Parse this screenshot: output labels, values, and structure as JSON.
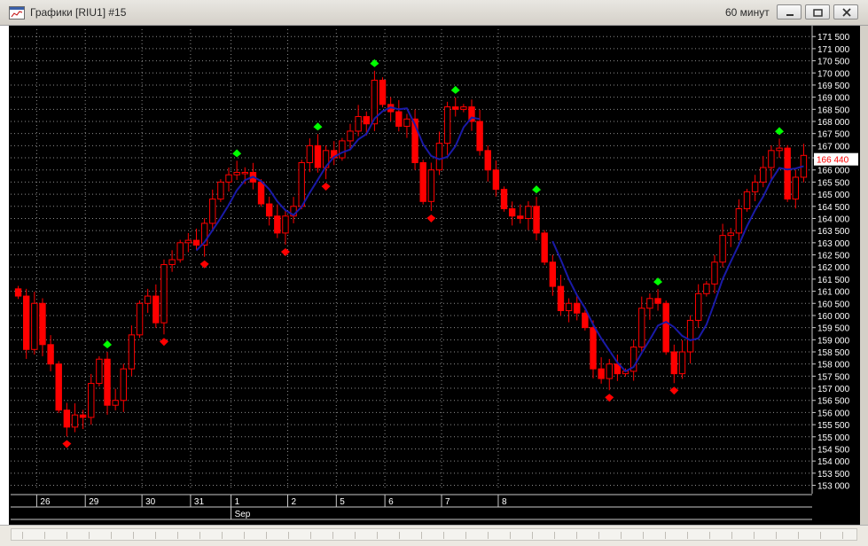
{
  "window": {
    "title": "Графики [RIU1] #15",
    "timeframe": "60 минут",
    "buttons": [
      "minimize",
      "restore",
      "close"
    ],
    "icons": {
      "app": "chart-window-icon",
      "minimize": "minimize-icon",
      "restore": "restore-icon",
      "close": "close-icon"
    }
  },
  "colors": {
    "background": "#000000",
    "grid": "#8c8c8c",
    "bear_candle": "#ff0000",
    "bull_candle": "#ff0000",
    "up_marker": "#00ff00",
    "down_marker": "#ff0000",
    "indicator_line": "#1a1aa8",
    "axis_text": "#ffffff",
    "price_label_bg": "#ffffff",
    "price_label_text": "#ff0000"
  },
  "chart_data": {
    "type": "candlestick",
    "instrument": "RIU1",
    "y_ticks": [
      "153 000",
      "153 500",
      "154 000",
      "154 500",
      "155 000",
      "155 500",
      "156 000",
      "156 500",
      "157 000",
      "157 500",
      "158 000",
      "158 500",
      "159 000",
      "159 500",
      "160 000",
      "160 500",
      "161 000",
      "161 500",
      "162 000",
      "162 500",
      "163 000",
      "163 500",
      "164 000",
      "164 500",
      "165 000",
      "165 500",
      "166 000",
      "166 500",
      "167 000",
      "167 500",
      "168 000",
      "168 500",
      "169 000",
      "169 500",
      "170 000",
      "170 500",
      "171 000",
      "171 500"
    ],
    "ylim": [
      152800,
      171800
    ],
    "last_price_label": "166 440",
    "x_day_labels": [
      {
        "label": "26",
        "index": 3
      },
      {
        "label": "29",
        "index": 9
      },
      {
        "label": "30",
        "index": 16
      },
      {
        "label": "31",
        "index": 22
      },
      {
        "label": "1",
        "index": 27
      },
      {
        "label": "2",
        "index": 34
      },
      {
        "label": "5",
        "index": 40
      },
      {
        "label": "6",
        "index": 46
      },
      {
        "label": "7",
        "index": 53
      },
      {
        "label": "8",
        "index": 60
      }
    ],
    "month_label": {
      "label": "Sep",
      "index": 27
    },
    "close": [
      160800,
      158600,
      160500,
      158800,
      158000,
      156100,
      155400,
      155900,
      155800,
      157200,
      158200,
      156300,
      156500,
      157800,
      159200,
      160500,
      160800,
      159700,
      162100,
      162300,
      163000,
      163100,
      162900,
      163800,
      164800,
      165500,
      165800,
      165900,
      165900,
      165500,
      164600,
      164100,
      163400,
      164100,
      164500,
      166300,
      167000,
      166100,
      166800,
      166500,
      167200,
      167600,
      168200,
      167900,
      169700,
      168700,
      168400,
      167800,
      168100,
      166300,
      164700,
      166000,
      167100,
      168600,
      168500,
      168600,
      168000,
      166800,
      166000,
      165200,
      164400,
      164100,
      164000,
      164500,
      163400,
      162200,
      161200,
      160200,
      160500,
      160100,
      159500,
      157800,
      157400,
      158000,
      157600,
      157700,
      158700,
      160300,
      160700,
      160500,
      158500,
      157600,
      158500,
      159800,
      160900,
      161300,
      162200,
      163300,
      163400,
      164400,
      165100,
      165500,
      166100,
      166800,
      166900,
      164800,
      165700,
      166600
    ]
  },
  "indicators": {
    "up_marker_label": "fractal-up",
    "down_marker_label": "fractal-down"
  }
}
